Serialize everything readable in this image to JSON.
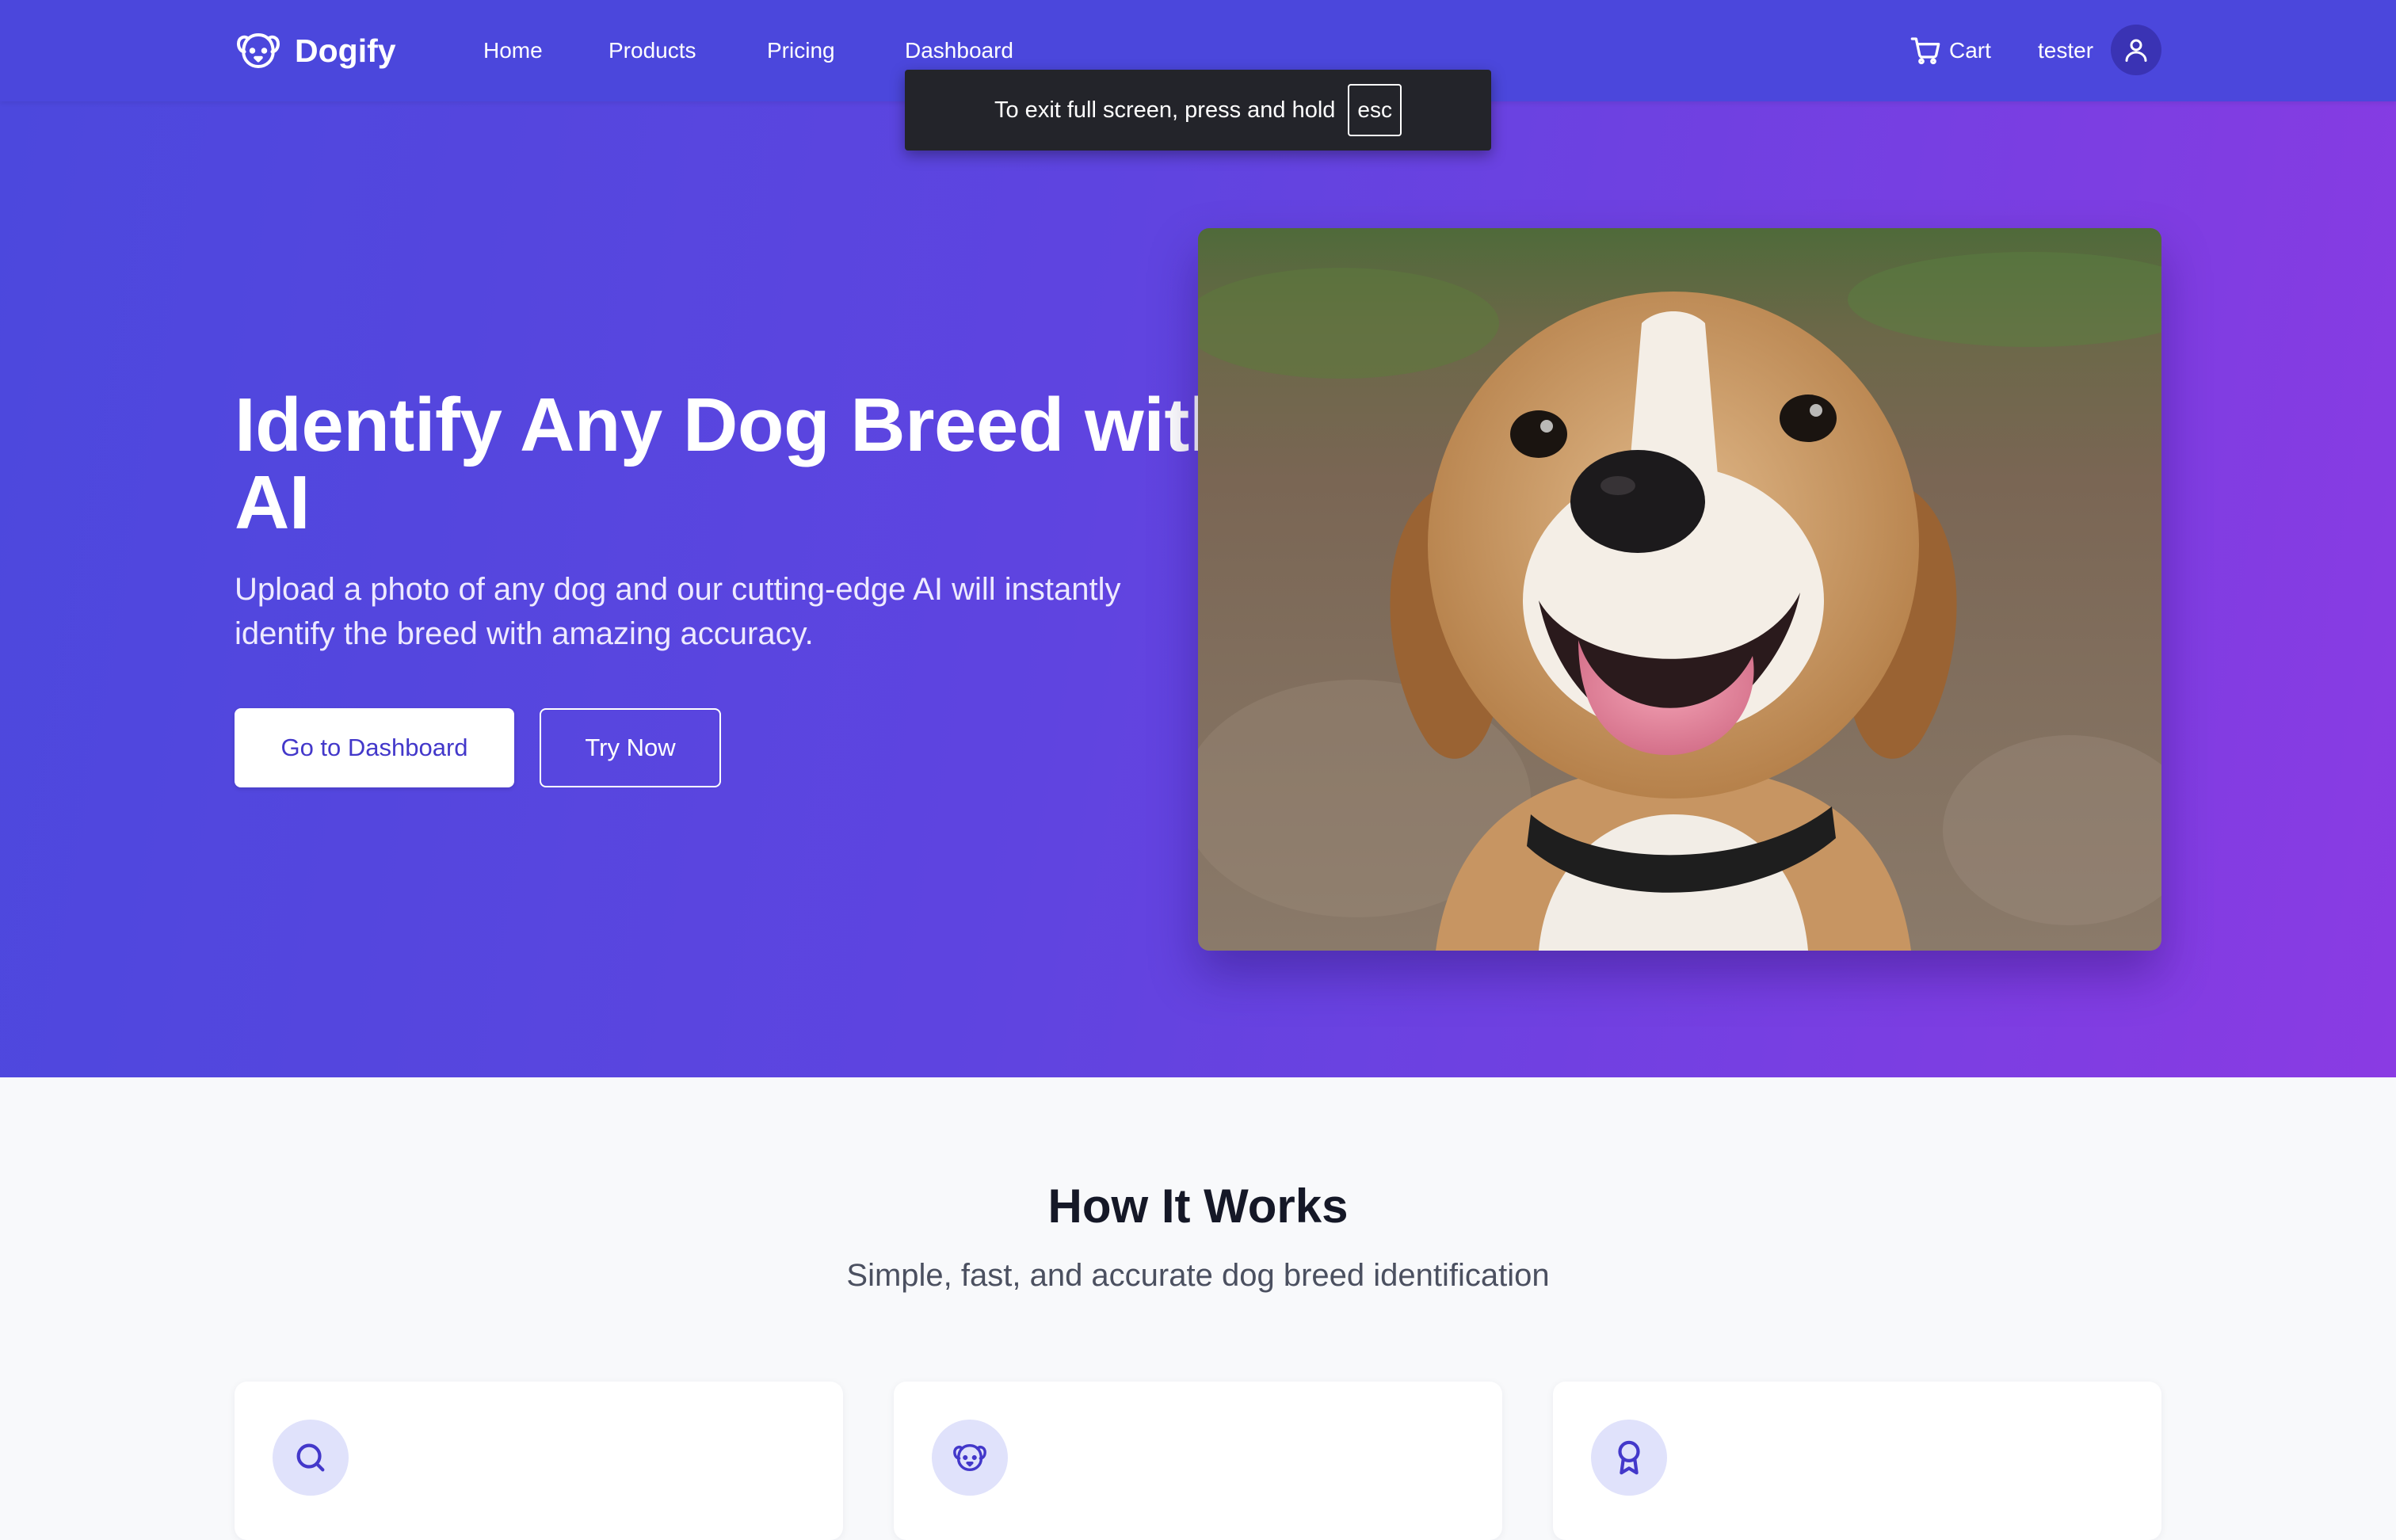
{
  "header": {
    "brand": "Dogify",
    "brand_icon": "dog-face-icon",
    "nav": [
      "Home",
      "Products",
      "Pricing",
      "Dashboard"
    ],
    "cart_label": "Cart",
    "cart_icon": "shopping-cart-icon",
    "username": "tester",
    "avatar_icon": "user-icon"
  },
  "fullscreen_toast": {
    "text": "To exit full screen, press and hold",
    "key": "esc"
  },
  "hero": {
    "title": "Identify Any Dog Breed with AI",
    "subtitle": "Upload a photo of any dog and our cutting-edge AI will instantly identify the breed with amazing accuracy.",
    "primary_button": "Go to Dashboard",
    "secondary_button": "Try Now",
    "image": "smiling-beagle-photo"
  },
  "how_it_works": {
    "title": "How It Works",
    "subtitle": "Simple, fast, and accurate dog breed identification",
    "card_icons": [
      "search-icon",
      "dog-face-icon",
      "award-icon"
    ]
  },
  "colors": {
    "header_bg": "#4b47dc",
    "hero_gradient_start": "#4c48dd",
    "hero_gradient_end": "#8a3be3",
    "accent": "#4338ca",
    "section_bg": "#f8f9fb"
  }
}
